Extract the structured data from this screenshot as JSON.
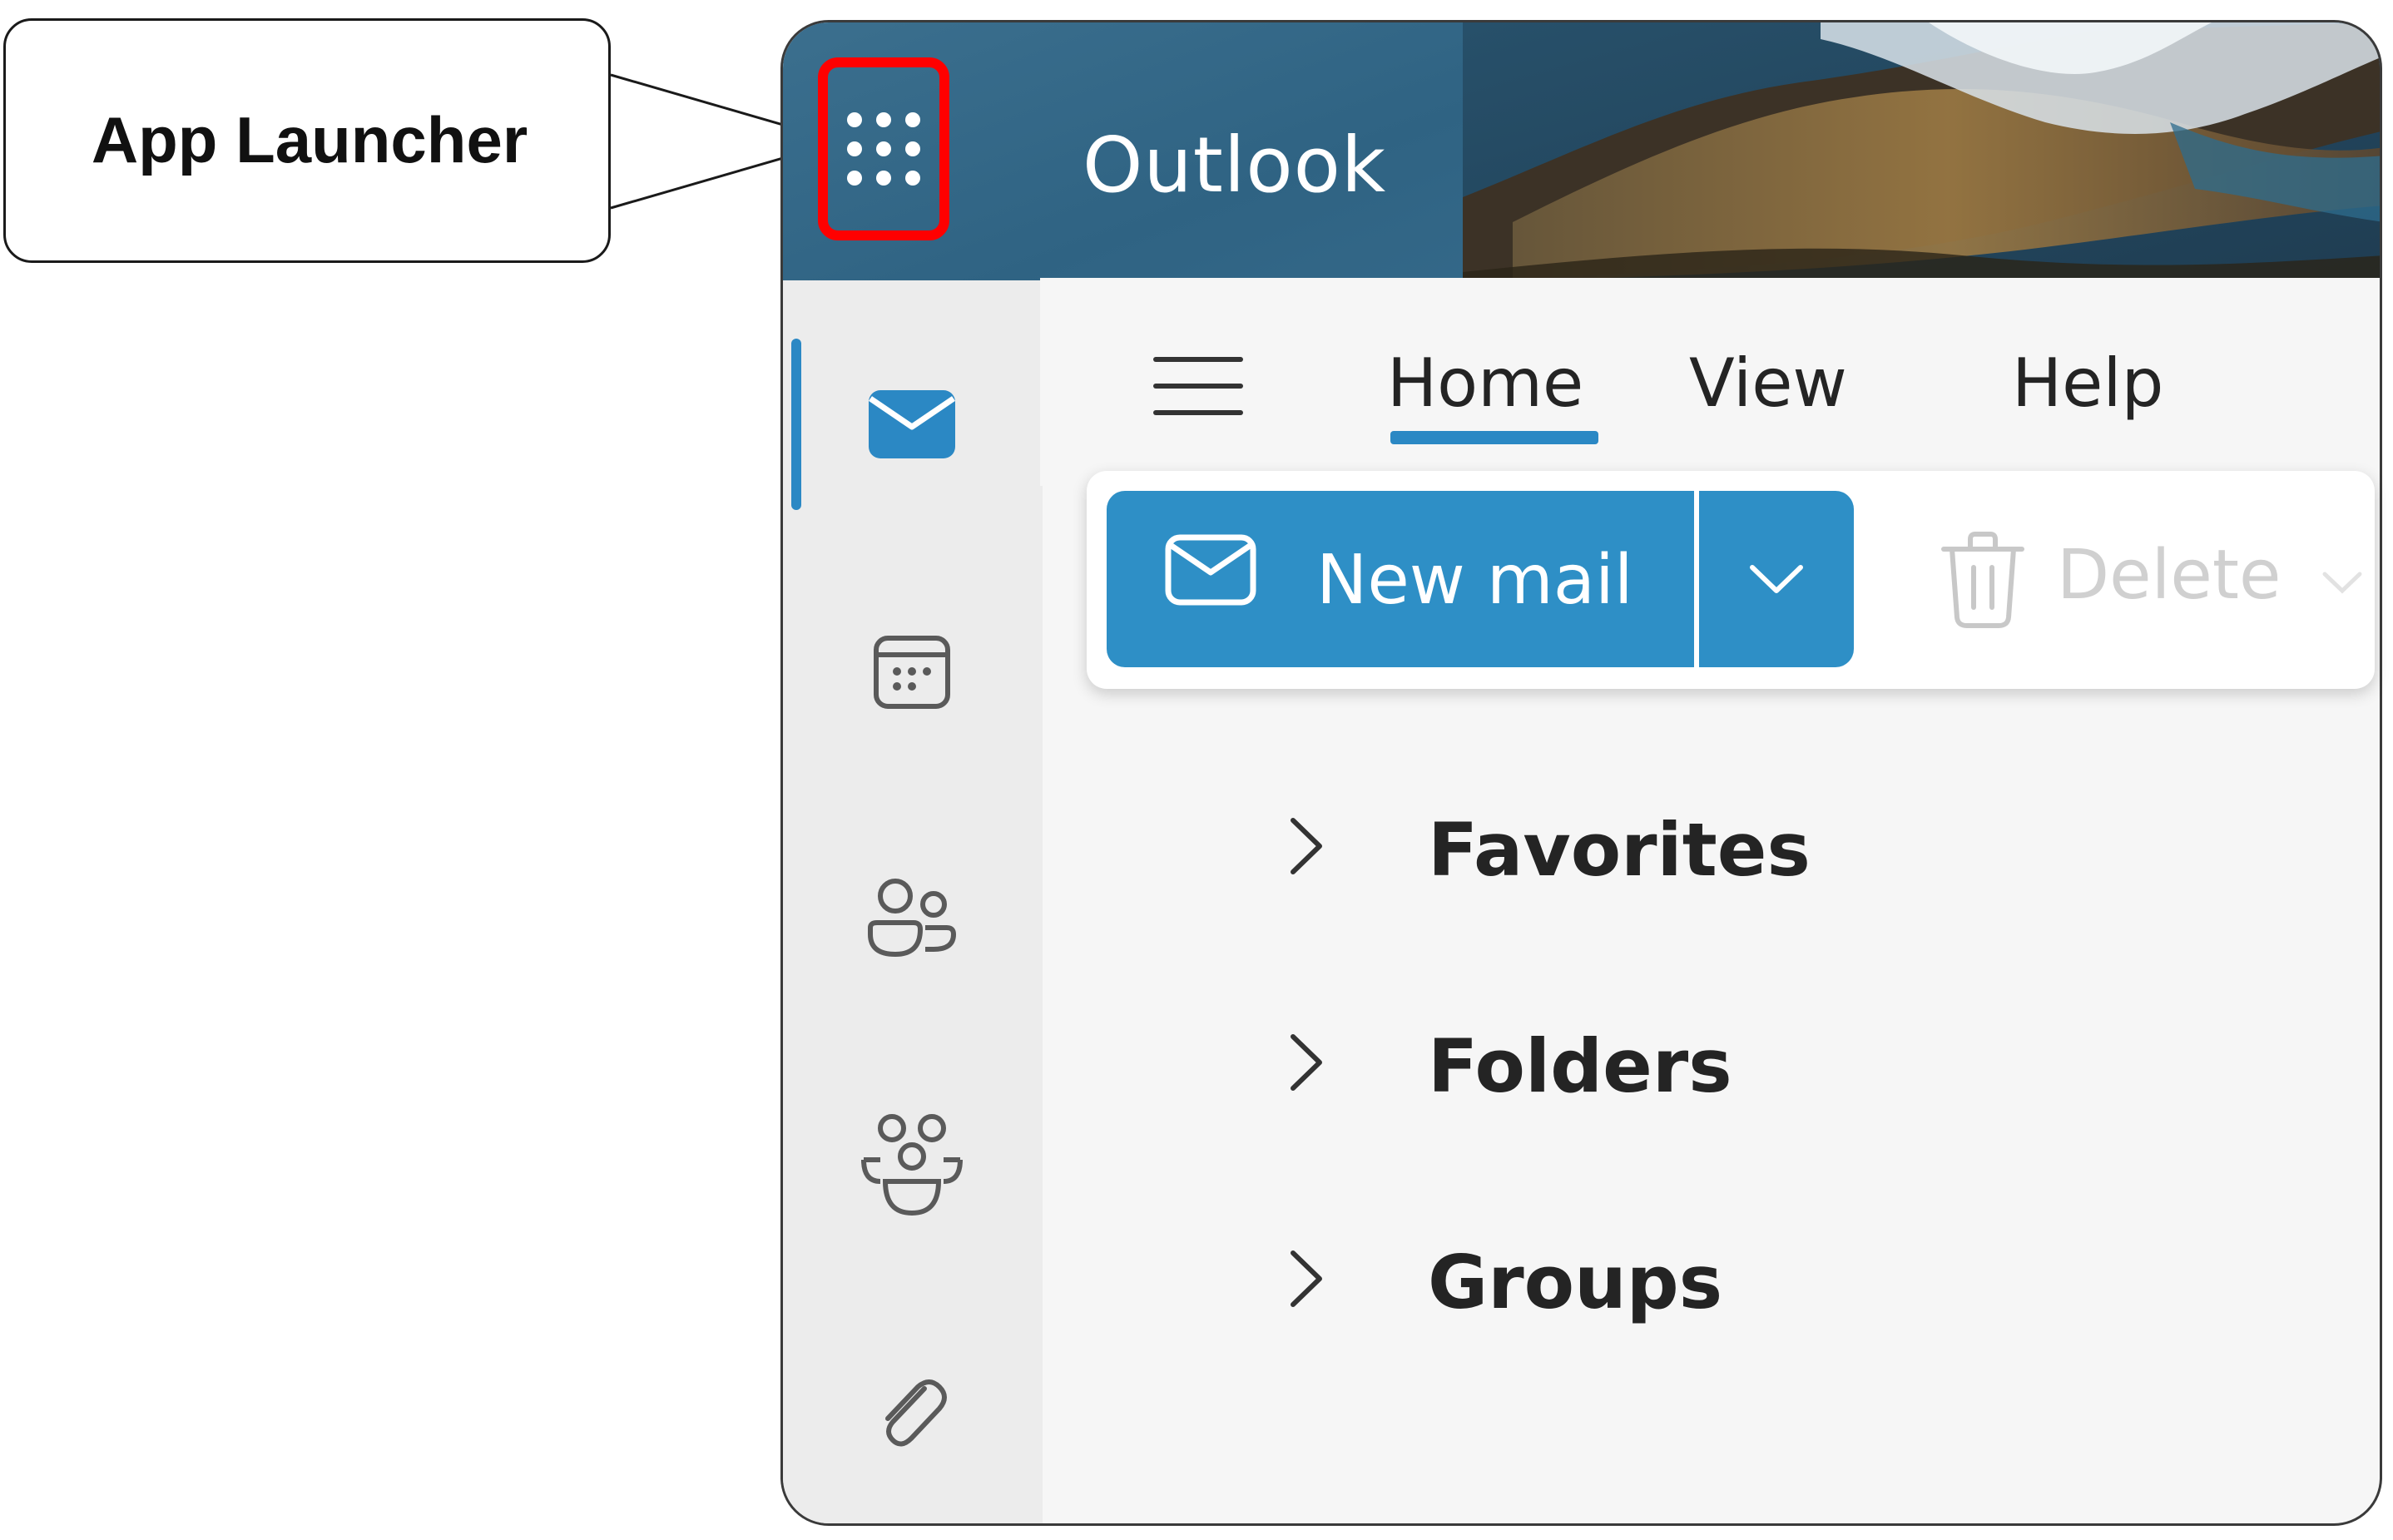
{
  "callout": {
    "label": "App Launcher"
  },
  "header": {
    "app_title": "Outlook",
    "launcher_icon": "app-launcher-grid-icon",
    "highlight_color": "#ff0000",
    "header_color": "#326788"
  },
  "rail": {
    "items": [
      {
        "icon": "mail-icon",
        "active": true
      },
      {
        "icon": "calendar-icon",
        "active": false
      },
      {
        "icon": "people-icon",
        "active": false
      },
      {
        "icon": "groups-icon",
        "active": false
      },
      {
        "icon": "attachment-icon",
        "active": false
      }
    ],
    "accent_color": "#2b88c4"
  },
  "ribbon": {
    "tabs": [
      {
        "label": "Home",
        "selected": true
      },
      {
        "label": "View",
        "selected": false
      },
      {
        "label": "Help",
        "selected": false
      }
    ],
    "new_mail_label": "New mail",
    "delete_label": "Delete",
    "primary_color": "#2e8fc6"
  },
  "folders": {
    "items": [
      {
        "label": "Favorites"
      },
      {
        "label": "Folders"
      },
      {
        "label": "Groups"
      }
    ]
  }
}
